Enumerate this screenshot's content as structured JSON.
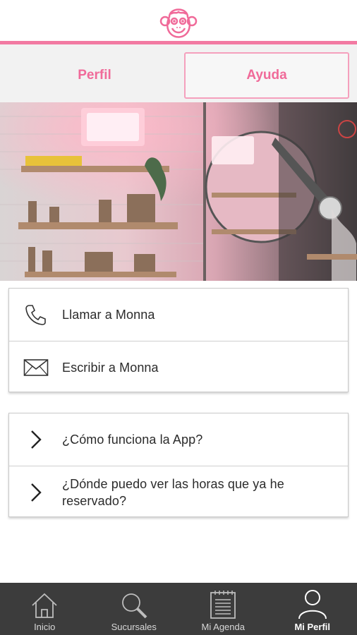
{
  "header": {
    "logo_icon": "monkey-logo-icon",
    "accent_color": "#f27aa2"
  },
  "tabs": [
    {
      "label": "Perfil",
      "selected": false
    },
    {
      "label": "Ayuda",
      "selected": true
    }
  ],
  "hero": {
    "image_icon": "salon-photo"
  },
  "contact": [
    {
      "icon": "phone-icon",
      "label": "Llamar a Monna"
    },
    {
      "icon": "envelope-icon",
      "label": "Escribir a Monna"
    }
  ],
  "faq": [
    {
      "icon": "chevron-right-icon",
      "label": "¿Cómo funciona la App?"
    },
    {
      "icon": "chevron-right-icon",
      "label": "¿Dónde puedo ver las horas que ya he reservado?"
    }
  ],
  "bottom_nav": [
    {
      "icon": "home-icon",
      "label": "Inicio",
      "active": false
    },
    {
      "icon": "search-icon",
      "label": "Sucursales",
      "active": false
    },
    {
      "icon": "agenda-icon",
      "label": "Mi Agenda",
      "active": false
    },
    {
      "icon": "person-icon",
      "label": "Mi Perfil",
      "active": true
    }
  ]
}
